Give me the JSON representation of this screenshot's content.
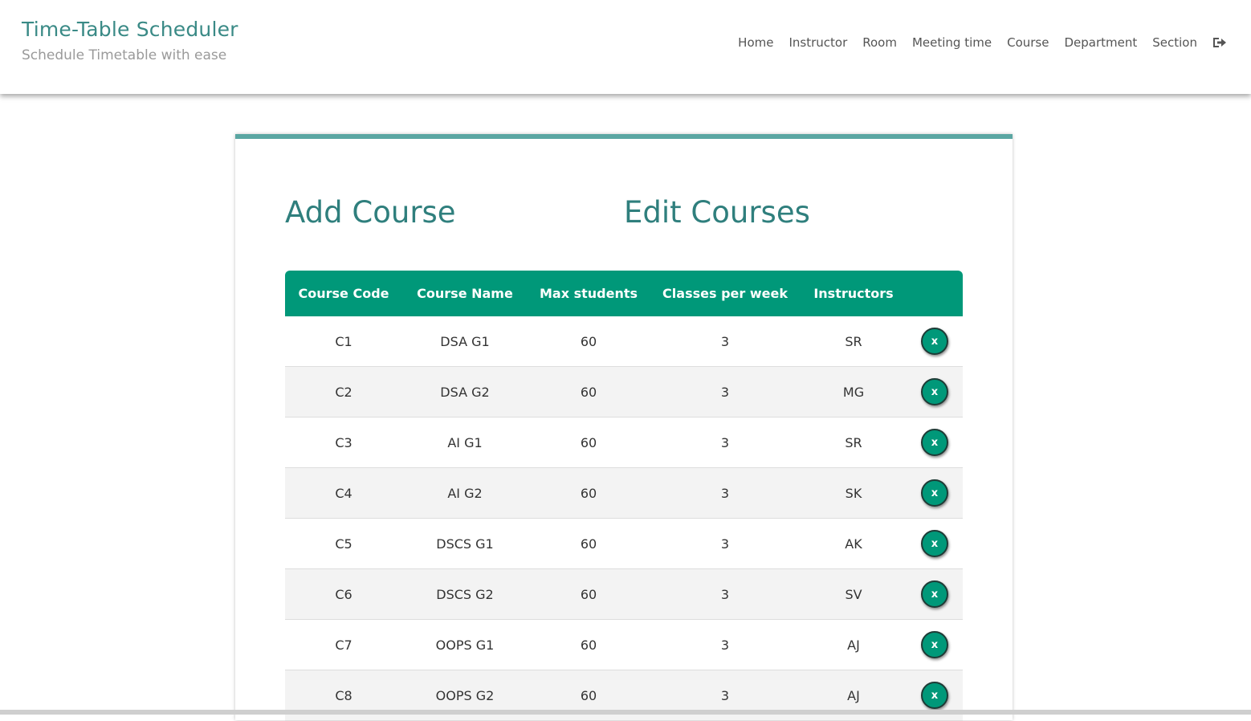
{
  "brand": {
    "title": "Time-Table Scheduler",
    "subtitle": "Schedule Timetable with ease"
  },
  "nav": {
    "items": [
      "Home",
      "Instructor",
      "Room",
      "Meeting time",
      "Course",
      "Department",
      "Section"
    ],
    "logout_icon": "sign-out-icon"
  },
  "tabs": {
    "add": "Add Course",
    "edit": "Edit Courses"
  },
  "table": {
    "headers": [
      "Course Code",
      "Course Name",
      "Max students",
      "Classes per week",
      "Instructors"
    ],
    "delete_label": "x",
    "rows": [
      [
        "C1",
        "DSA G1",
        "60",
        "3",
        "SR"
      ],
      [
        "C2",
        "DSA G2",
        "60",
        "3",
        "MG"
      ],
      [
        "C3",
        "AI G1",
        "60",
        "3",
        "SR"
      ],
      [
        "C4",
        "AI G2",
        "60",
        "3",
        "SK"
      ],
      [
        "C5",
        "DSCS G1",
        "60",
        "3",
        "AK"
      ],
      [
        "C6",
        "DSCS G2",
        "60",
        "3",
        "SV"
      ],
      [
        "C7",
        "OOPS G1",
        "60",
        "3",
        "AJ"
      ],
      [
        "C8",
        "OOPS G2",
        "60",
        "3",
        "AJ"
      ]
    ]
  },
  "colors": {
    "accent": "#009879",
    "brand": "#3a8a86",
    "card_border": "#5aa6a2"
  }
}
